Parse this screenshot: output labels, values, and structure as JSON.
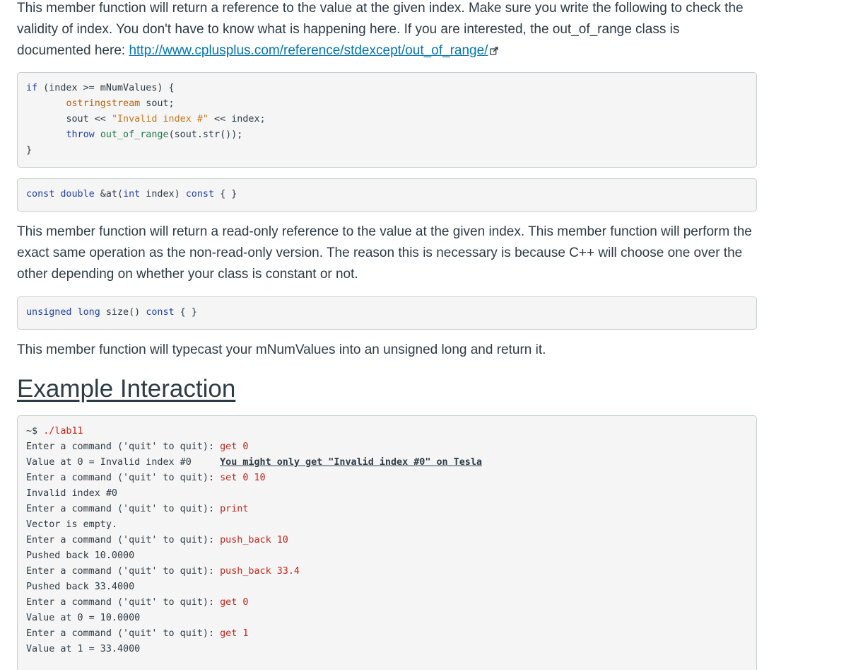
{
  "intro": {
    "text": "This member function will return a reference to the value at the given index. Make sure you write the following to check the validity of index. You don't have to know what is happening here. If you are interested, the out_of_range class is documented here: ",
    "link_text": "http://www.cplusplus.com/reference/stdexcept/out_of_range/",
    "link_icon": "external-link-icon"
  },
  "code_check": {
    "l1_kw": "if",
    "l1_rest": " (index >= mNumValues) {",
    "l2_indent": "       ",
    "l2_type": "ostringstream",
    "l2_rest": " sout;",
    "l3_indent": "       ",
    "l3_pre": "sout << ",
    "l3_str": "\"Invalid index #\"",
    "l3_post": " << index;",
    "l4_indent": "       ",
    "l4_kw": "throw",
    "l4_fn": "out_of_range",
    "l4_rest": "(sout.str());",
    "l5": "}"
  },
  "code_at_const": {
    "kw1": "const",
    "kw2": "double",
    "mid1": " &at(",
    "kw3": "int",
    "mid2": " index) ",
    "kw4": "const",
    "end": " { }"
  },
  "para_at_const": "This member function will return a read-only reference to the value at the given index. This member function will perform the exact same operation as the non-read-only version. The reason this is necessary is because C++ will choose one over the other depending on whether your class is constant or not.",
  "code_size": {
    "kw1": "unsigned",
    "kw2": "long",
    "mid": " size() ",
    "kw3": "const",
    "end": " { }"
  },
  "para_size": "This member function will typecast your mNumValues into an unsigned long and return it.",
  "heading": "Example Interaction",
  "interaction": {
    "prompt_line": "~$ ",
    "prompt_cmd": "./lab11",
    "lines": [
      {
        "text": "Enter a command ('quit' to quit): ",
        "cmd": "get 0",
        "note": ""
      },
      {
        "text": "Value at 0 = Invalid index #0     ",
        "cmd": "",
        "note": "You might only get \"Invalid index #0\" on Tesla"
      },
      {
        "text": "Enter a command ('quit' to quit): ",
        "cmd": "set 0 10",
        "note": ""
      },
      {
        "text": "Invalid index #0",
        "cmd": "",
        "note": ""
      },
      {
        "text": "Enter a command ('quit' to quit): ",
        "cmd": "print",
        "note": ""
      },
      {
        "text": "Vector is empty.",
        "cmd": "",
        "note": ""
      },
      {
        "text": "Enter a command ('quit' to quit): ",
        "cmd": "push_back 10",
        "note": ""
      },
      {
        "text": "Pushed back 10.0000",
        "cmd": "",
        "note": ""
      },
      {
        "text": "Enter a command ('quit' to quit): ",
        "cmd": "push_back 33.4",
        "note": ""
      },
      {
        "text": "Pushed back 33.4000",
        "cmd": "",
        "note": ""
      },
      {
        "text": "Enter a command ('quit' to quit): ",
        "cmd": "get 0",
        "note": ""
      },
      {
        "text": "Value at 0 = 10.0000",
        "cmd": "",
        "note": ""
      },
      {
        "text": "Enter a command ('quit' to quit): ",
        "cmd": "get 1",
        "note": ""
      },
      {
        "text": "Value at 1 = 33.4000",
        "cmd": "",
        "note": ""
      }
    ]
  },
  "colors": {
    "text": "#2d3b45",
    "link": "#0374b5",
    "keyword": "#1d3fa8",
    "type": "#b9610a",
    "string": "#c07a1e",
    "function": "#1f7a4b",
    "command": "#c2261a",
    "code_bg": "#f5f5f5",
    "code_border": "#c7cdd1"
  }
}
